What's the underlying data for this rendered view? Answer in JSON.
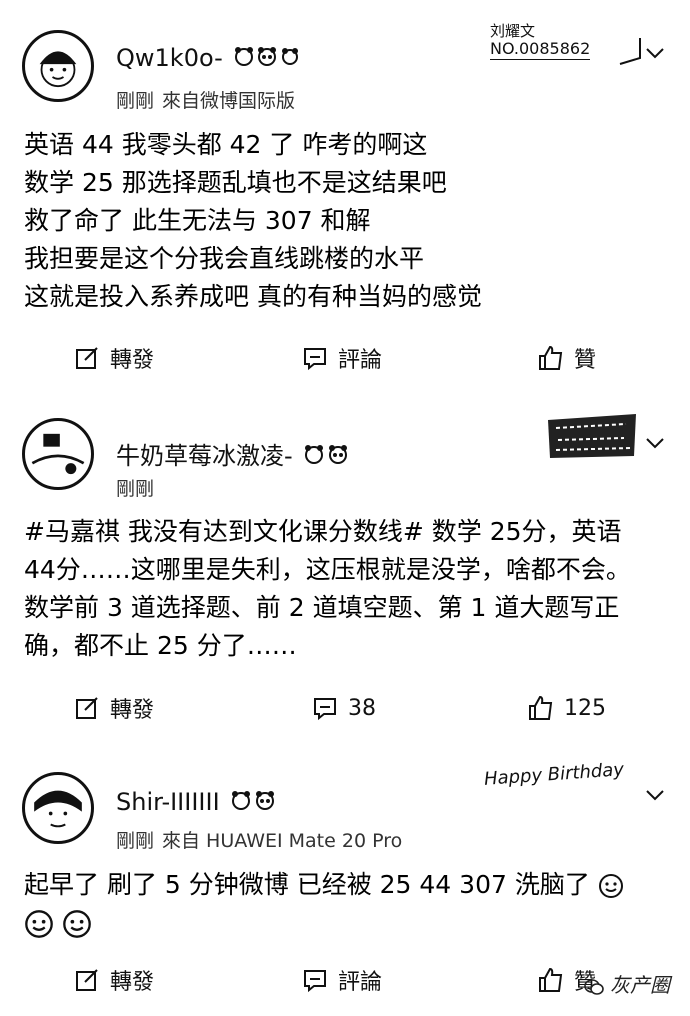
{
  "posts": [
    {
      "username": "Qw1k0o-",
      "time": "剛剛",
      "source": "來自微博国际版",
      "badge": {
        "name": "刘耀文",
        "number": "NO.0085862"
      },
      "lines": [
        "英语 44 我零头都 42 了 咋考的啊这",
        "数学 25 那选择题乱填也不是这结果吧",
        "救了命了 此生无法与 307 和解",
        "我担要是这个分我会直线跳楼的水平",
        "这就是投入系养成吧 真的有种当妈的感觉"
      ],
      "actions": {
        "repost": "轉發",
        "comment": "評論",
        "like": "贊"
      }
    },
    {
      "username": "牛奶草莓冰激凌-",
      "time": "剛剛",
      "source": "",
      "text": "#马嘉祺 我没有达到文化课分数线# 数学 25分，英语 44分……这哪里是失利，这压根就是没学，啥都不会。数学前 3 道选择题、前 2 道填空题、第 1 道大题写正确，都不止 25 分了……",
      "actions": {
        "repost": "轉發",
        "comment": "38",
        "like": "125"
      }
    },
    {
      "username": "Shir-IIIIIII",
      "time": "剛剛",
      "source": "來自 HUAWEI Mate 20 Pro",
      "badge": {
        "name": "Happy Birthday"
      },
      "lines": [
        "起早了 刷了 5 分钟微博 已经被 25 44 307 洗脑了"
      ],
      "actions": {
        "repost": "轉發",
        "comment": "評論",
        "like": "贊"
      }
    }
  ],
  "watermark": "灰产圈"
}
